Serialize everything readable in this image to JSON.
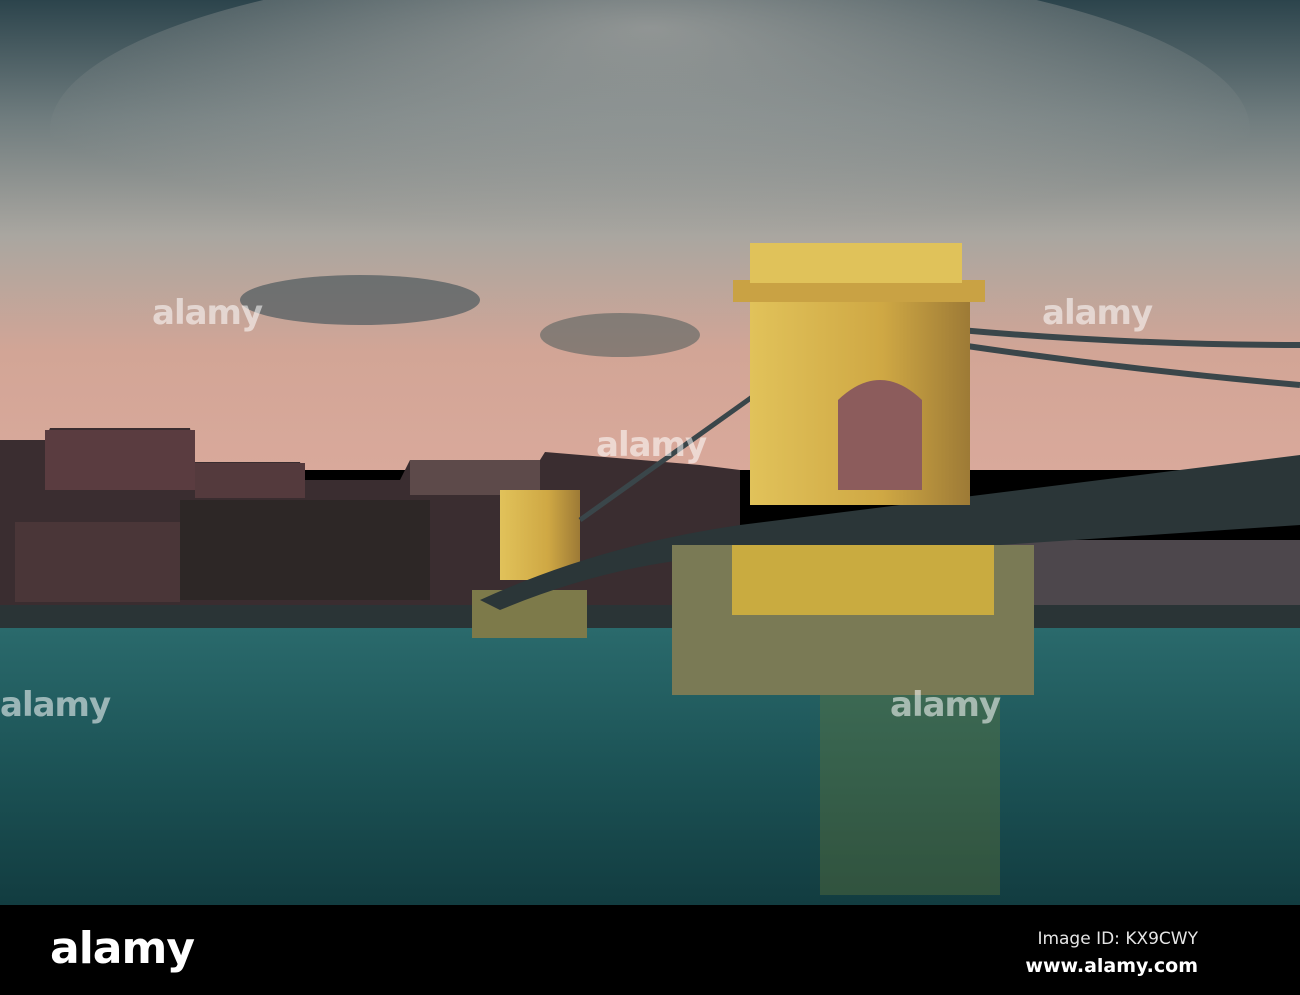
{
  "photo": {
    "subject": "Chain bridge over river at dusk",
    "watermark_text": "alamy"
  },
  "footer": {
    "logo": "alamy",
    "image_id": "Image ID: KX9CWY",
    "url": "www.alamy.com"
  },
  "colors": {
    "sky_top": "#2c444c",
    "sky_horizon": "#d8a898",
    "tower": "#d7b448",
    "water": "#1d5659",
    "bar": "#000000"
  }
}
